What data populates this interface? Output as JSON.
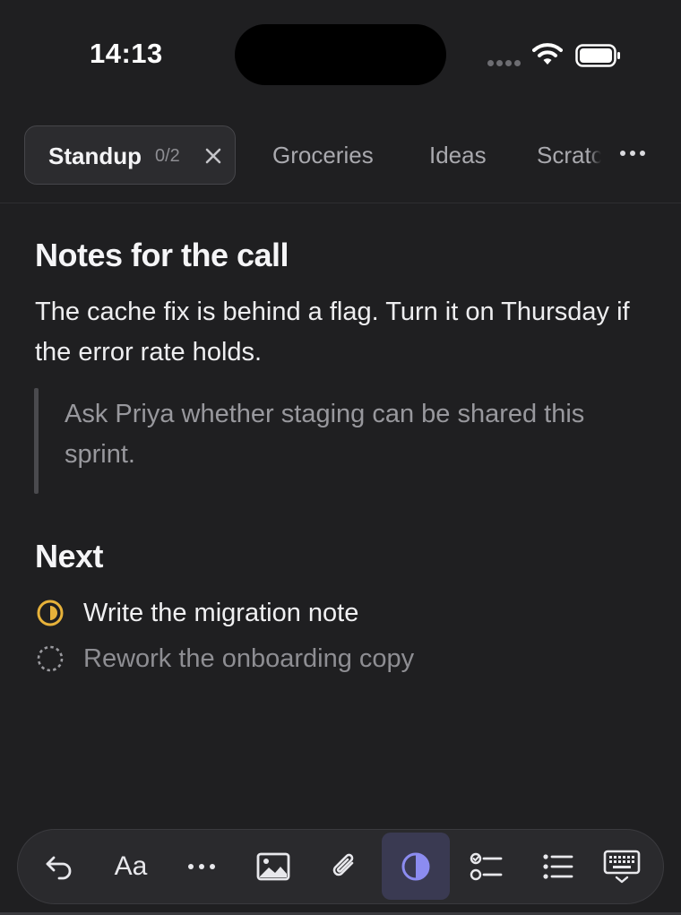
{
  "status_bar": {
    "time": "14:13",
    "icons": [
      "signal-dots-icon",
      "wifi-icon",
      "battery-icon"
    ]
  },
  "tabs": [
    {
      "label": "Standup",
      "count": "0/2",
      "active": true
    },
    {
      "label": "Groceries",
      "active": false
    },
    {
      "label": "Ideas",
      "active": false
    },
    {
      "label": "Scratch",
      "active": false
    }
  ],
  "note": {
    "heading": "Notes for the call",
    "paragraph": "The cache fix is behind a flag. Turn it on Thursday if the error rate holds.",
    "quote": "Ask Priya whether staging can be shared this sprint.",
    "section_heading": "Next",
    "tasks": [
      {
        "text": "Write the migration note",
        "state": "in-progress"
      },
      {
        "text": "Rework the onboarding copy",
        "state": "todo"
      }
    ]
  },
  "toolbar": {
    "text_style_label": "Aa",
    "buttons": [
      "undo-icon",
      "text-style",
      "more-icon",
      "image-icon",
      "attachment-icon",
      "contrast-icon",
      "checklist-icon",
      "bullet-list-icon",
      "keyboard-icon"
    ],
    "active_button": "contrast-icon"
  },
  "colors": {
    "background": "#1f1f21",
    "accent_yellow": "#e7b23a",
    "accent_purple": "#8c8cf0"
  }
}
